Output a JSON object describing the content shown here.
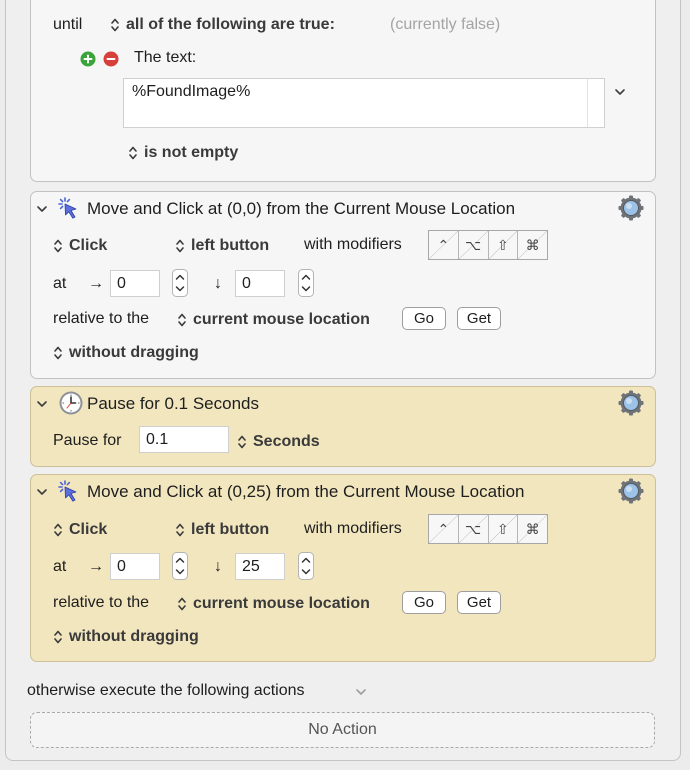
{
  "until_section": {
    "until_label": "until",
    "condition_selector": "all of the following are true:",
    "condition_status": "(currently false)",
    "text_condition_label": "The text:",
    "text_value": "%FoundImage%",
    "test_selector": "is not empty"
  },
  "actions": [
    {
      "title": "Move and Click at (0,0) from the Current Mouse Location",
      "click_type": "Click",
      "button": "left button",
      "modifiers_label": "with modifiers",
      "at_label": "at",
      "x": "0",
      "y": "0",
      "relative_label": "relative to the",
      "relative_to": "current mouse location",
      "go_button": "Go",
      "get_button": "Get",
      "drag_mode": "without dragging"
    },
    {
      "title": "Pause for 0.1 Seconds",
      "pause_label": "Pause for",
      "duration": "0.1",
      "unit": "Seconds"
    },
    {
      "title": "Move and Click at (0,25) from the Current Mouse Location",
      "click_type": "Click",
      "button": "left button",
      "modifiers_label": "with modifiers",
      "at_label": "at",
      "x": "0",
      "y": "25",
      "relative_label": "relative to the",
      "relative_to": "current mouse location",
      "go_button": "Go",
      "get_button": "Get",
      "drag_mode": "without dragging"
    }
  ],
  "modifier_keys": [
    "⌃",
    "⌥",
    "⇧",
    "⌘"
  ],
  "otherwise_label": "otherwise execute the following actions",
  "no_action_label": "No Action",
  "colors": {
    "selected_action_bg": "#f2e6bf",
    "action_bg": "#f6f6f6",
    "click_icon": "#4a63d6",
    "add_button": "#3aa43a",
    "remove_button": "#d6403a"
  },
  "icons": {
    "add": "plus-circle-icon",
    "remove": "minus-circle-icon",
    "click_action": "mouse-click-icon",
    "pause_action": "clock-icon",
    "gear": "gear-icon",
    "disclosure": "chevron-down-icon",
    "selector": "up-down-arrows-icon"
  }
}
